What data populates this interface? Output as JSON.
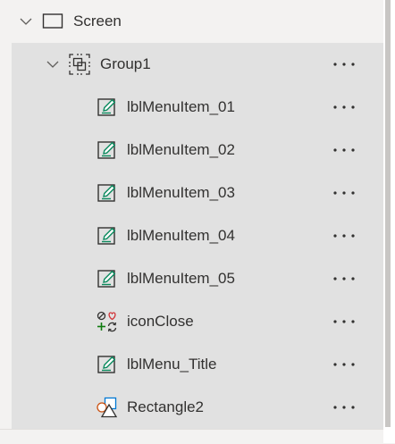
{
  "tree": {
    "screen": {
      "label": "Screen",
      "icon": "screen-icon"
    },
    "group": {
      "label": "Group1",
      "icon": "group-icon"
    },
    "items": [
      {
        "label": "lblMenuItem_01",
        "icon": "label-edit-icon"
      },
      {
        "label": "lblMenuItem_02",
        "icon": "label-edit-icon"
      },
      {
        "label": "lblMenuItem_03",
        "icon": "label-edit-icon"
      },
      {
        "label": "lblMenuItem_04",
        "icon": "label-edit-icon"
      },
      {
        "label": "lblMenuItem_05",
        "icon": "label-edit-icon"
      },
      {
        "label": "iconClose",
        "icon": "icons-control-icon"
      },
      {
        "label": "lblMenu_Title",
        "icon": "label-edit-icon"
      },
      {
        "label": "Rectangle2",
        "icon": "shapes-icon"
      }
    ]
  },
  "colors": {
    "group_background": "#e1e1e1",
    "panel_background": "#f3f2f1",
    "edit_icon_accent": "#0b8a5e",
    "icon_stroke": "#323130"
  }
}
